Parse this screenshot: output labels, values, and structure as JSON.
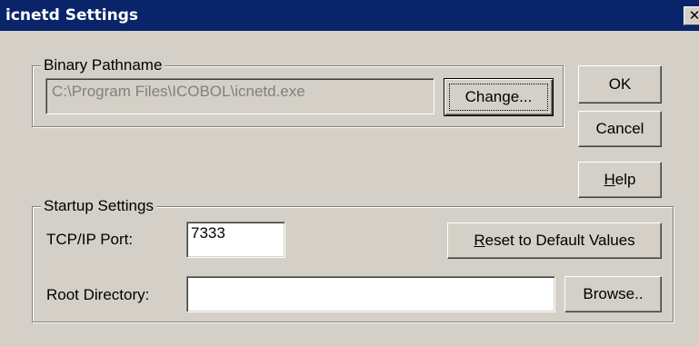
{
  "window": {
    "title": "icnetd Settings",
    "close_glyph": "✕"
  },
  "binary_group": {
    "label": "Binary Pathname",
    "path_value": "C:\\Program Files\\ICOBOL\\icnetd.exe",
    "change_label": "Change..."
  },
  "buttons": {
    "ok": "OK",
    "cancel": "Cancel",
    "help_mnemonic": "H",
    "help_rest": "elp"
  },
  "startup_group": {
    "label": "Startup Settings",
    "port_label": "TCP/IP Port:",
    "port_value": "7333",
    "reset_mnemonic": "R",
    "reset_rest": "eset to Default Values",
    "root_label": "Root Directory:",
    "root_value": "",
    "browse_label": "Browse.."
  }
}
